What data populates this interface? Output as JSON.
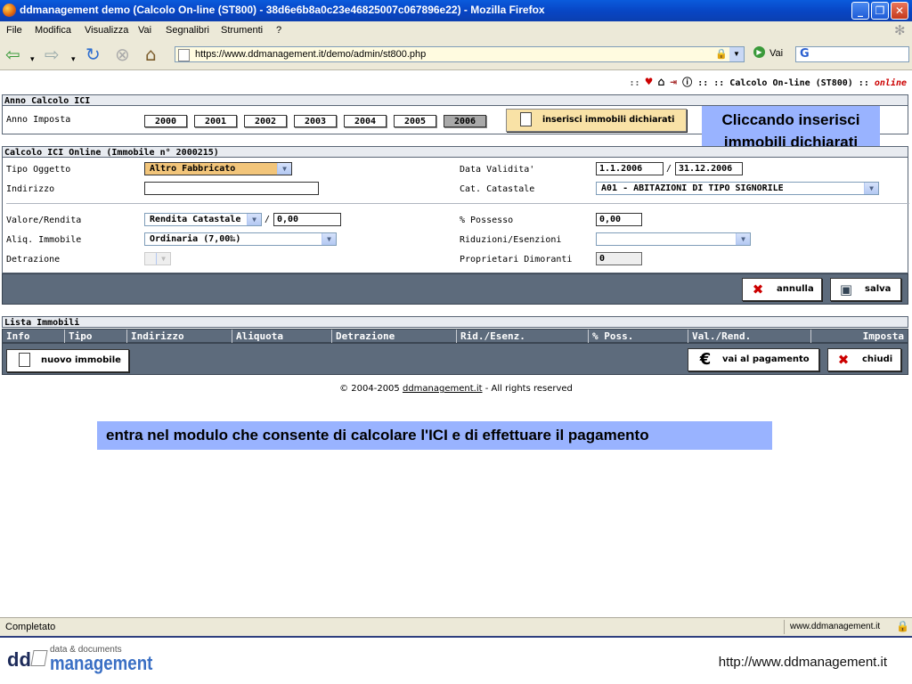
{
  "window": {
    "title": "ddmanagement demo (Calcolo On-line (ST800) - 38d6e6b8a0c23e46825007c067896e22) - Mozilla Firefox"
  },
  "menu": [
    "File",
    "Modifica",
    "Visualizza",
    "Vai",
    "Segnalibri",
    "Strumenti",
    "?"
  ],
  "nav": {
    "url": "https://www.ddmanagement.it/demo/admin/st800.php",
    "go_label": "Vai",
    "search_value": "G"
  },
  "page": {
    "topbar_text": ":: :: Calcolo On-line (ST800) ::",
    "topbar_online": "online",
    "anno": {
      "header": "Anno Calcolo ICI",
      "label": "Anno Imposta",
      "years": [
        "2000",
        "2001",
        "2002",
        "2003",
        "2004",
        "2005",
        "2006"
      ],
      "selected_year": "2006",
      "insert_button": "inserisci immobili dichiarati"
    },
    "calcolo": {
      "header": "Calcolo ICI Online (Immobile n° 2000215)",
      "tipo_oggetto_label": "Tipo Oggetto",
      "tipo_oggetto_value": "Altro Fabbricato",
      "indirizzo_label": "Indirizzo",
      "indirizzo_value": "",
      "data_validita_label": "Data Validita'",
      "data_from": "1.1.2006",
      "data_sep": "/",
      "data_to": "31.12.2006",
      "cat_catastale_label": "Cat. Catastale",
      "cat_catastale_value": "A01 - ABITAZIONI DI TIPO SIGNORILE",
      "valore_label": "Valore/Rendita",
      "valore_type": "Rendita Catastale",
      "valore_sep": "/",
      "valore_value": "0,00",
      "possesso_label": "% Possesso",
      "possesso_value": "0,00",
      "aliq_label": "Aliq. Immobile",
      "aliq_value": "Ordinaria (7,00‰)",
      "riduzioni_label": "Riduzioni/Esenzioni",
      "riduzioni_value": "",
      "detrazione_label": "Detrazione",
      "proprietari_label": "Proprietari Dimoranti",
      "proprietari_value": "0",
      "annulla": "annulla",
      "salva": "salva"
    },
    "lista": {
      "header": "Lista Immobili",
      "columns": [
        "Info",
        "Tipo",
        "Indirizzo",
        "Aliquota",
        "Detrazione",
        "Rid./Esenz.",
        "% Poss.",
        "Val./Rend.",
        "Imposta"
      ],
      "nuovo": "nuovo immobile",
      "pagamento": "vai al pagamento",
      "chiudi": "chiudi"
    },
    "copyright_prefix": "© 2004-2005",
    "copyright_link": "ddmanagement.it",
    "copyright_suffix": "- All rights reserved"
  },
  "callouts": {
    "insert_note": "Cliccando inserisci immobili dichiarati",
    "bottom_note": "entra nel modulo che consente di calcolare l'ICI e di effettuare il pagamento"
  },
  "status": {
    "left": "Completato",
    "right": "www.ddmanagement.it"
  },
  "footer": {
    "logo_dd": "dd",
    "logo_small": "data & documents",
    "logo_big": "management",
    "url": "http://www.ddmanagement.it"
  },
  "colors": {
    "callout_bg": "#99b3ff",
    "section_bar": "#5d6b7c",
    "online_red": "#cc0000"
  }
}
